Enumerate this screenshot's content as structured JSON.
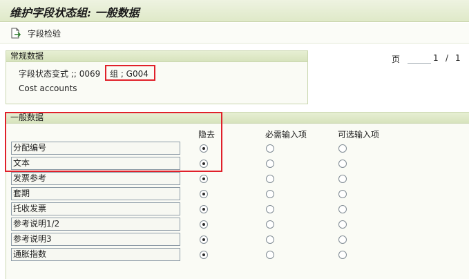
{
  "window": {
    "title": "维护字段状态组: 一般数据"
  },
  "toolbar": {
    "field_check_label": "字段检验",
    "field_check_icon": "document-check-icon"
  },
  "general": {
    "header": "常规数据",
    "variant_text": "字段状态变式 ;; 0069",
    "group_text": "组 ; G004",
    "description": "Cost accounts"
  },
  "pager": {
    "label": "页",
    "current": "1",
    "separator": "/",
    "total": "1"
  },
  "section": {
    "header": "一般数据",
    "columns": {
      "hide": "隐去",
      "required": "必需输入项",
      "optional": "可选输入项"
    },
    "rows": [
      {
        "label": "分配编号",
        "selected": "hide"
      },
      {
        "label": "文本",
        "selected": "hide"
      },
      {
        "label": "发票参考",
        "selected": "hide"
      },
      {
        "label": "套期",
        "selected": "hide"
      },
      {
        "label": "托收发票",
        "selected": "hide"
      },
      {
        "label": "参考说明1/2",
        "selected": "hide"
      },
      {
        "label": "参考说明3",
        "selected": "hide"
      },
      {
        "label": "通胀指数",
        "selected": "hide"
      }
    ]
  },
  "colors": {
    "highlight": "#e0202a",
    "header_bg": "#dfe9c8"
  }
}
